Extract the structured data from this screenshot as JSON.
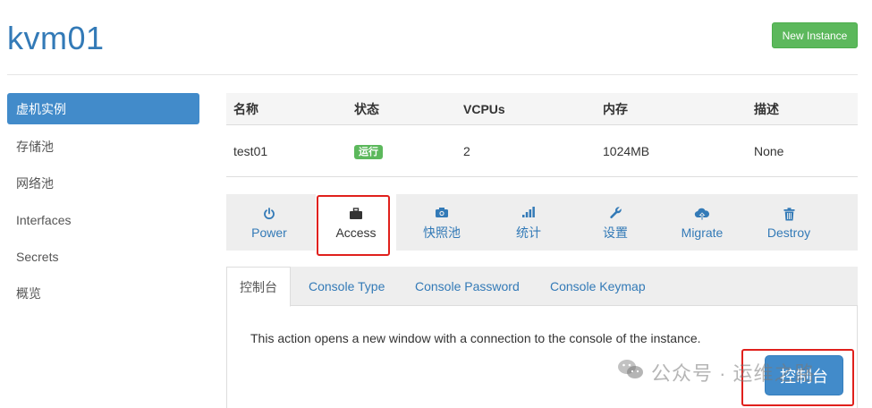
{
  "header": {
    "title": "kvm01",
    "new_instance_label": "New Instance"
  },
  "sidebar": {
    "items": [
      {
        "label": "虚机实例"
      },
      {
        "label": "存储池"
      },
      {
        "label": "网络池"
      },
      {
        "label": "Interfaces"
      },
      {
        "label": "Secrets"
      },
      {
        "label": "概览"
      }
    ]
  },
  "table": {
    "headers": [
      "名称",
      "状态",
      "VCPUs",
      "内存",
      "描述"
    ],
    "rows": [
      {
        "name": "test01",
        "status": "运行",
        "vcpus": "2",
        "memory": "1024MB",
        "description": "None"
      }
    ]
  },
  "actions": [
    {
      "label": "Power",
      "icon": "power-icon"
    },
    {
      "label": "Access",
      "icon": "briefcase-icon"
    },
    {
      "label": "快照池",
      "icon": "camera-icon"
    },
    {
      "label": "统计",
      "icon": "signal-bars-icon"
    },
    {
      "label": "设置",
      "icon": "wrench-icon"
    },
    {
      "label": "Migrate",
      "icon": "cloud-upload-icon"
    },
    {
      "label": "Destroy",
      "icon": "trash-icon"
    }
  ],
  "tabs": [
    {
      "label": "控制台"
    },
    {
      "label": "Console Type"
    },
    {
      "label": "Console Password"
    },
    {
      "label": "Console Keymap"
    }
  ],
  "panel": {
    "description": "This action opens a new window with a connection to the console of the instance.",
    "button_label": "控制台"
  },
  "watermark": {
    "text": "公众号 · 运维之路"
  },
  "colors": {
    "accent": "#428bca",
    "link": "#337ab7",
    "success": "#5cb85c",
    "highlight": "#e0201c"
  }
}
